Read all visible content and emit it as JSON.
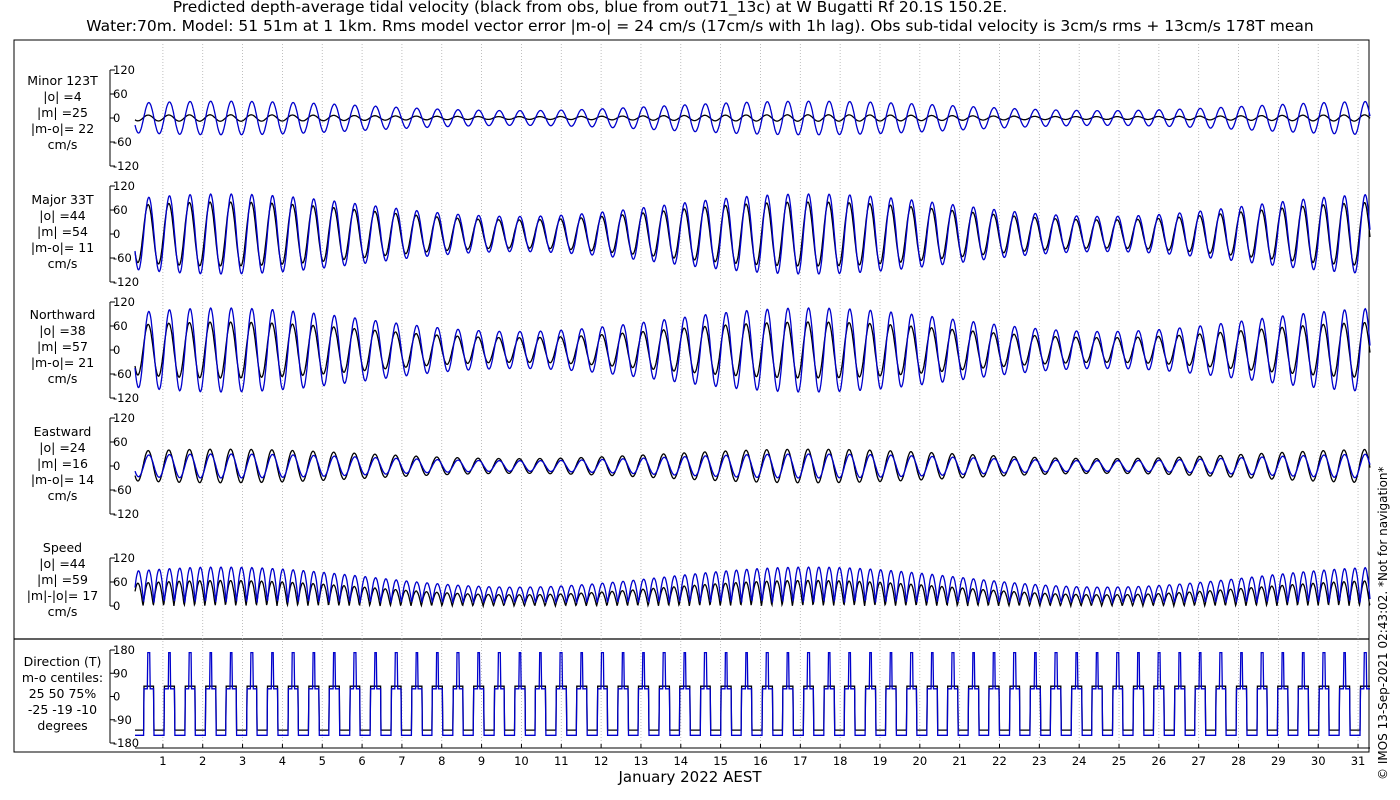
{
  "title": {
    "line1": "Predicted depth-average tidal velocity (black from obs, blue from out71_13c) at W Bugatti Rf 20.1S 150.2E.",
    "line2": "Water:70m. Model: 51 51m at 1 1km. Rms model vector error |m-o| = 24 cm/s (17cm/s with 1h lag). Obs sub-tidal velocity is 3cm/s rms + 13cm/s 178T mean"
  },
  "xlabel": "January 2022 AEST",
  "credit": "© IMOS 13-Sep-2021 02:43:02. *Not for navigation*",
  "colors": {
    "obs": "#000000",
    "model": "#0000cc",
    "grid": "#b0b0b0"
  },
  "chart_data": {
    "type": "line",
    "x_unit": "day of January 2022",
    "x_ticks": [
      1,
      2,
      3,
      4,
      5,
      6,
      7,
      8,
      9,
      10,
      11,
      12,
      13,
      14,
      15,
      16,
      17,
      18,
      19,
      20,
      21,
      22,
      23,
      24,
      25,
      26,
      27,
      28,
      29,
      30,
      31
    ],
    "xlim": [
      0.3,
      31.3
    ],
    "grid": "vertical dotted at each day",
    "series_colors": {
      "obs": "black",
      "model": "blue"
    },
    "panels": [
      {
        "label": [
          "Minor 123T",
          "|o| =4",
          "|m| =25",
          "|m-o|= 22",
          "cm/s"
        ],
        "ylim": [
          -120,
          120
        ],
        "yticks": [
          120,
          60,
          0,
          -60,
          -120
        ],
        "obs_amplitude": 8,
        "model_amplitude": 42,
        "kind": "tidal"
      },
      {
        "label": [
          "Major 33T",
          "|o| =44",
          "|m| =54",
          "|m-o|= 11",
          "cm/s"
        ],
        "ylim": [
          -120,
          120
        ],
        "yticks": [
          120,
          60,
          0,
          -60,
          -120
        ],
        "obs_amplitude": 80,
        "model_amplitude": 100,
        "kind": "tidal"
      },
      {
        "label": [
          "Northward",
          "|o| =38",
          "|m| =57",
          "|m-o|= 21",
          "cm/s"
        ],
        "ylim": [
          -120,
          120
        ],
        "yticks": [
          120,
          60,
          0,
          -60,
          -120
        ],
        "obs_amplitude": 70,
        "model_amplitude": 105,
        "kind": "tidal"
      },
      {
        "label": [
          "Eastward",
          "|o| =24",
          "|m| =16",
          "|m-o|= 14",
          "cm/s"
        ],
        "ylim": [
          -120,
          120
        ],
        "yticks": [
          120,
          60,
          0,
          -60,
          -60,
          -120
        ],
        "obs_amplitude": 42,
        "model_amplitude": 30,
        "kind": "tidal"
      },
      {
        "label": [
          "Speed",
          "|o| =44",
          "|m| =59",
          "|m|-|o|= 17",
          "cm/s"
        ],
        "ylim": [
          0,
          120
        ],
        "yticks": [
          120,
          60,
          0
        ],
        "obs_amplitude": 75,
        "model_amplitude": 105,
        "kind": "speed"
      },
      {
        "label": [
          "Direction (T)",
          "m-o centiles:",
          "25  50  75%",
          "-25 -19 -10",
          "degrees"
        ],
        "ylim": [
          -180,
          180
        ],
        "yticks": [
          180,
          90,
          0,
          -90,
          -180
        ],
        "kind": "direction"
      }
    ]
  }
}
